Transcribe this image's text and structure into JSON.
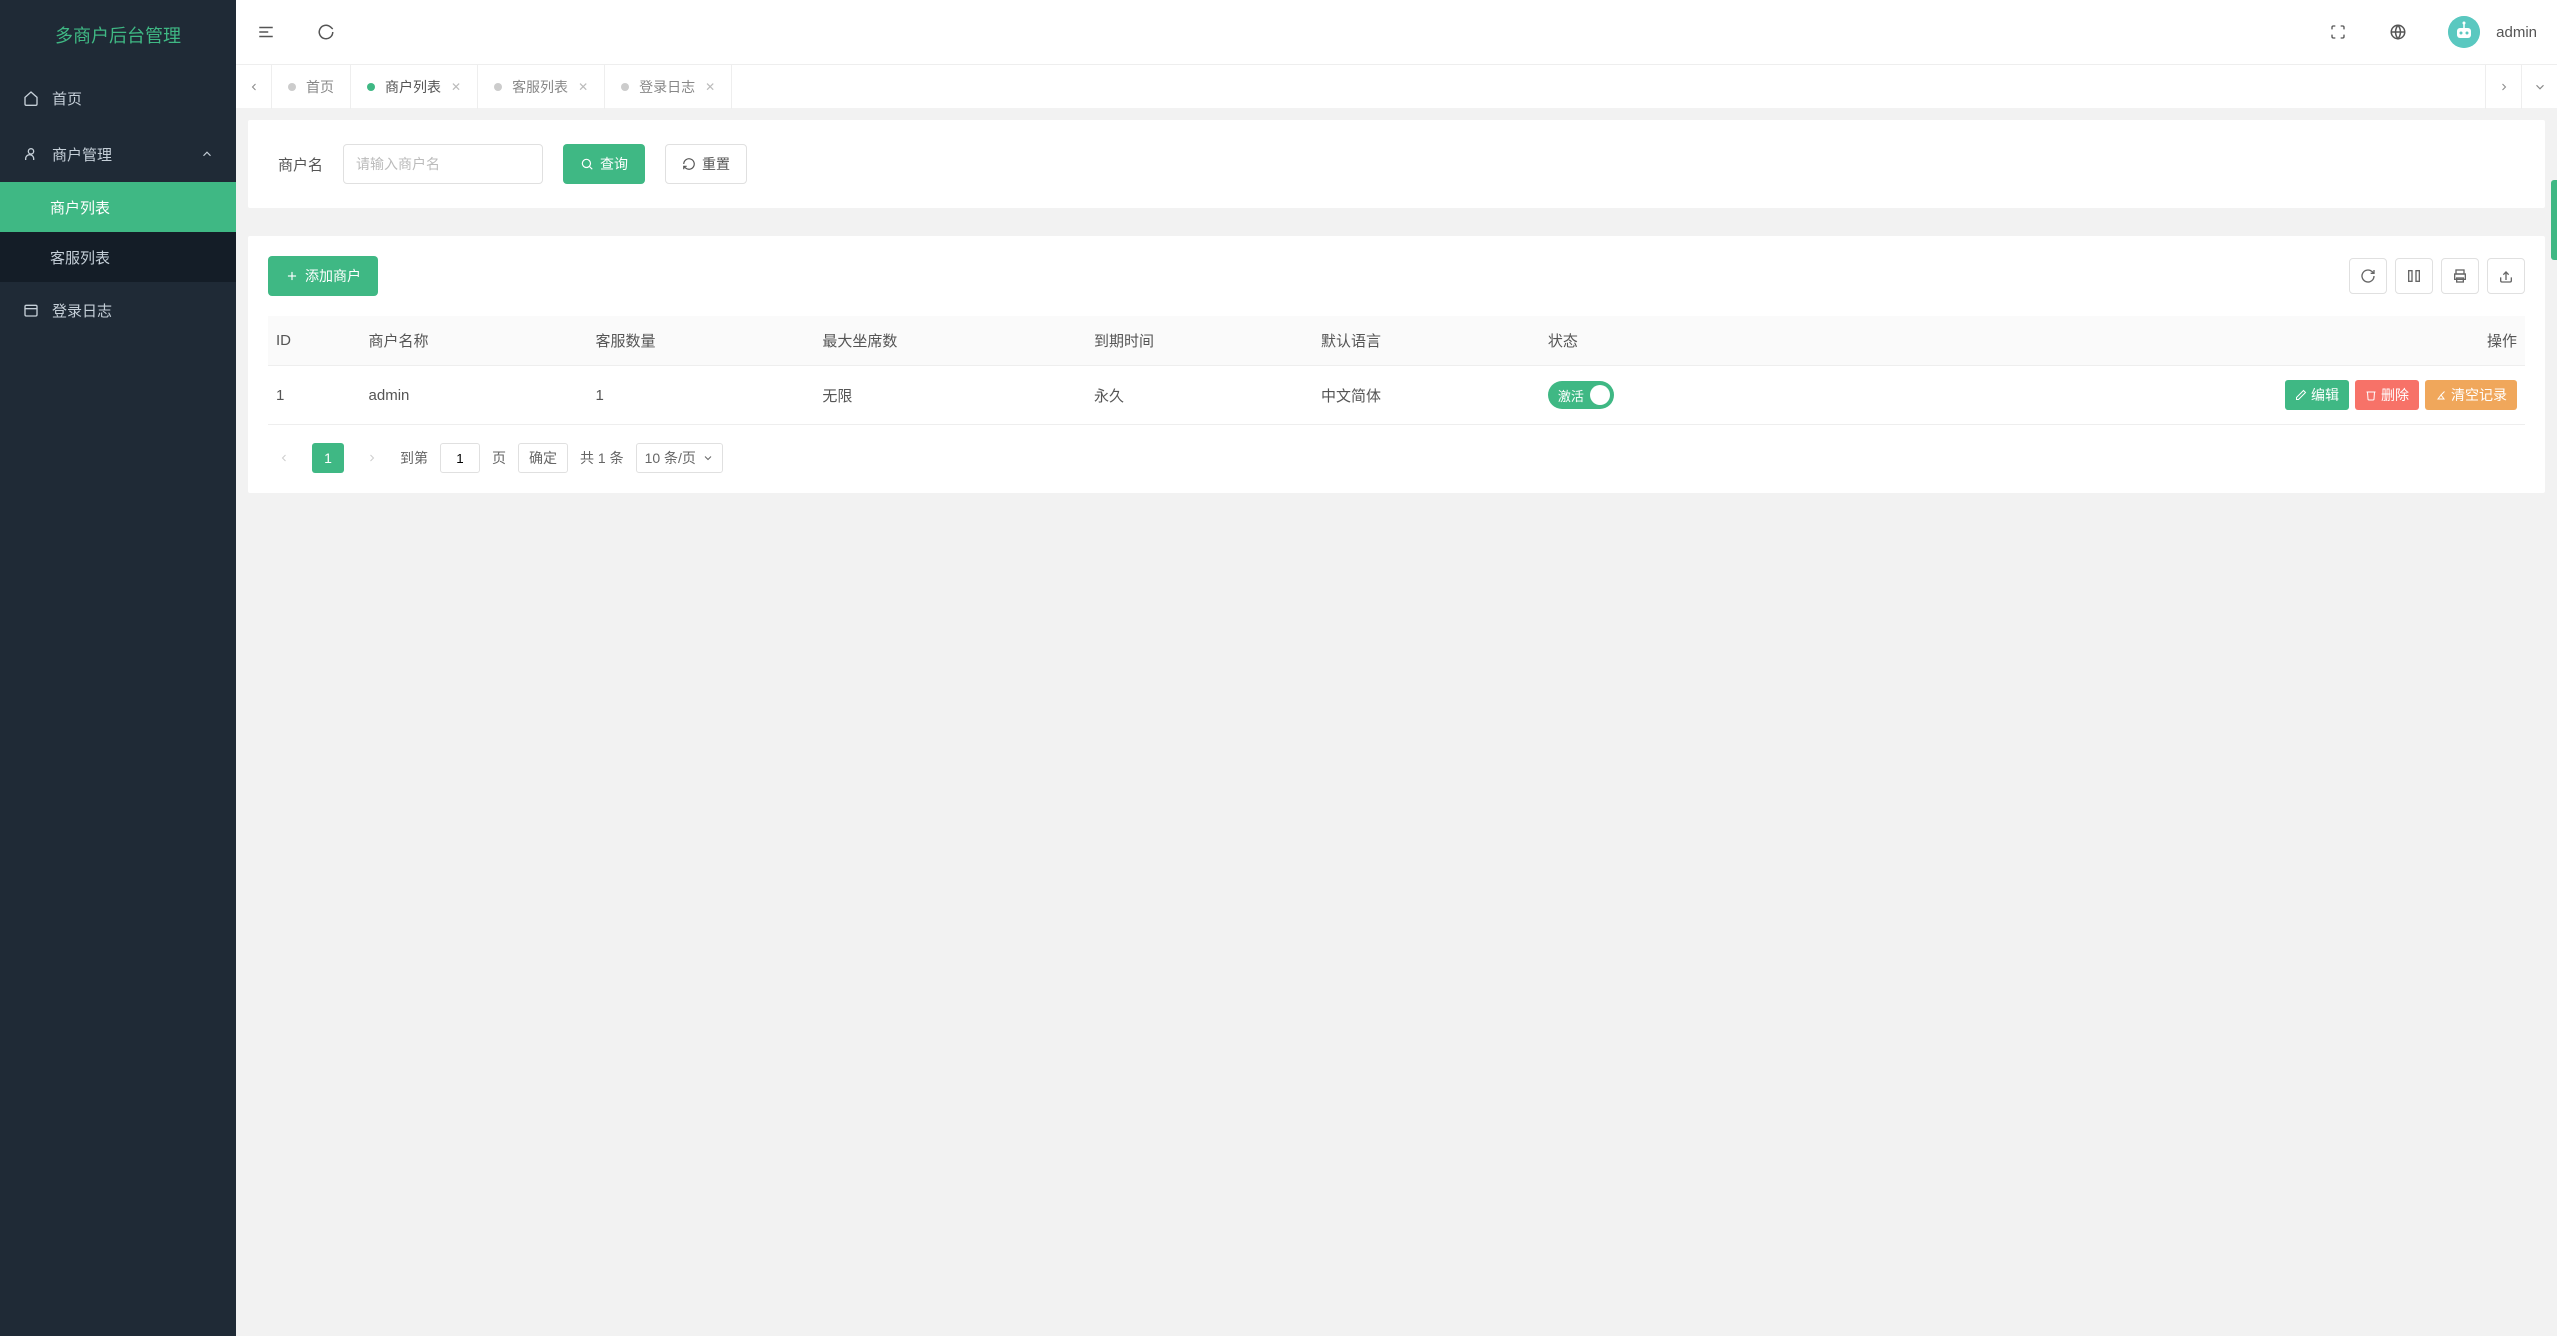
{
  "brand": "多商户后台管理",
  "sidebar": {
    "home": "首页",
    "merchant_mgmt": "商户管理",
    "merchant_list": "商户列表",
    "agent_list": "客服列表",
    "login_log": "登录日志"
  },
  "header": {
    "username": "admin"
  },
  "tabs": [
    {
      "label": "首页",
      "closable": false,
      "active": false
    },
    {
      "label": "商户列表",
      "closable": true,
      "active": true
    },
    {
      "label": "客服列表",
      "closable": true,
      "active": false
    },
    {
      "label": "登录日志",
      "closable": true,
      "active": false
    }
  ],
  "filter": {
    "label": "商户名",
    "placeholder": "请输入商户名",
    "search_btn": "查询",
    "reset_btn": "重置"
  },
  "toolbar": {
    "add_btn": "添加商户"
  },
  "table": {
    "headers": {
      "id": "ID",
      "name": "商户名称",
      "agents": "客服数量",
      "max_seats": "最大坐席数",
      "expiry": "到期时间",
      "lang": "默认语言",
      "status": "状态",
      "actions": "操作"
    },
    "rows": [
      {
        "id": "1",
        "name": "admin",
        "agents": "1",
        "max_seats": "无限",
        "expiry": "永久",
        "lang": "中文简体",
        "status_label": "激活"
      }
    ],
    "action_edit": "编辑",
    "action_delete": "删除",
    "action_clear": "清空记录"
  },
  "pagination": {
    "current": "1",
    "jump_prefix": "到第",
    "jump_input": "1",
    "jump_suffix": "页",
    "confirm": "确定",
    "total": "共 1 条",
    "page_size": "10 条/页"
  }
}
